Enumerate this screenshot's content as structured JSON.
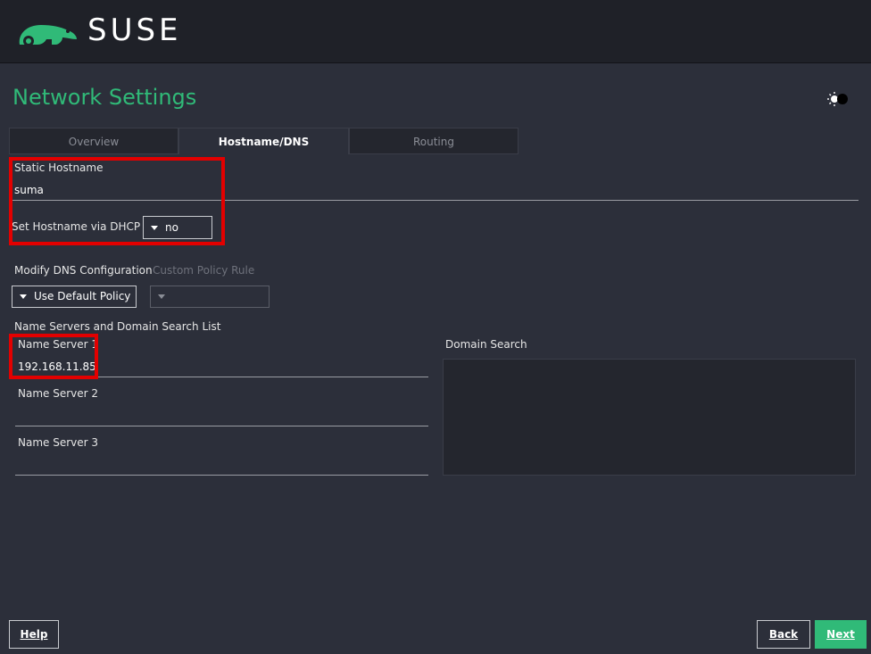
{
  "header": {
    "brand": "SUSE"
  },
  "page": {
    "title": "Network Settings"
  },
  "tabs": [
    {
      "label": "Overview",
      "active": false
    },
    {
      "label": "Hostname/DNS",
      "active": true
    },
    {
      "label": "Routing",
      "active": false
    }
  ],
  "hostname": {
    "static_label": "Static Hostname",
    "static_value": "suma",
    "dhcp_label": "Set Hostname via DHCP",
    "dhcp_value": "no"
  },
  "dns": {
    "modify_label": "Modify DNS Configuration",
    "modify_value": "Use Default Policy",
    "custom_label": "Custom Policy Rule",
    "custom_value": "",
    "section_label": "Name Servers and Domain Search List",
    "ns1_label": "Name Server 1",
    "ns1_value": "192.168.11.85",
    "ns2_label": "Name Server 2",
    "ns2_value": "",
    "ns3_label": "Name Server 3",
    "ns3_value": "",
    "domain_search_label": "Domain Search",
    "domain_search_value": ""
  },
  "footer": {
    "help": "Help",
    "back": "Back",
    "next": "Next"
  },
  "colors": {
    "accent": "#30ba78",
    "highlight": "#e30000",
    "background": "#2c2f3a"
  },
  "icons": {
    "logo": "chameleon-logo-icon",
    "theme": "theme-toggle-icon"
  }
}
